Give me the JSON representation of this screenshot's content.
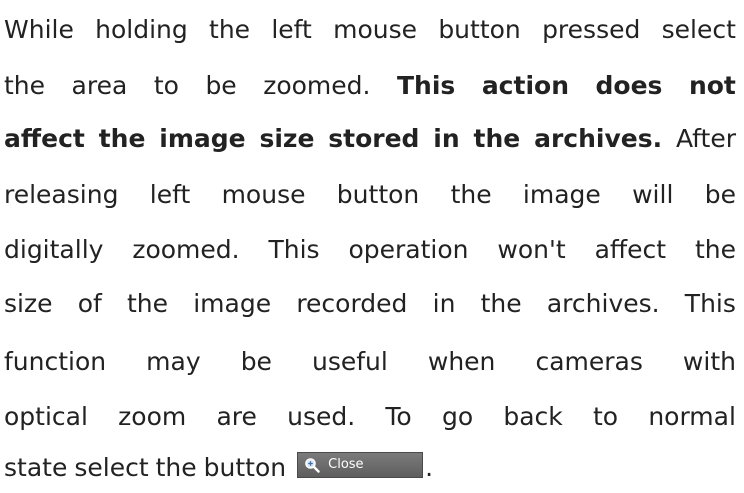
{
  "paragraph": {
    "lines": [
      [
        {
          "t": "While"
        },
        {
          "t": "holding"
        },
        {
          "t": "the"
        },
        {
          "t": "left"
        },
        {
          "t": "mouse"
        },
        {
          "t": "button"
        },
        {
          "t": "pressed"
        },
        {
          "t": "select"
        }
      ],
      [
        {
          "t": "the"
        },
        {
          "t": "area"
        },
        {
          "t": "to"
        },
        {
          "t": "be"
        },
        {
          "t": "zoomed."
        },
        {
          "t": "This",
          "b": true
        },
        {
          "t": "action",
          "b": true
        },
        {
          "t": "does",
          "b": true
        },
        {
          "t": "not",
          "b": true
        }
      ],
      [
        {
          "t": "affect",
          "b": true
        },
        {
          "t": "the",
          "b": true
        },
        {
          "t": "image",
          "b": true
        },
        {
          "t": "size",
          "b": true
        },
        {
          "t": "stored",
          "b": true
        },
        {
          "t": "in",
          "b": true
        },
        {
          "t": "the",
          "b": true
        },
        {
          "t": "archives.",
          "b": true
        },
        {
          "t": "After"
        }
      ],
      [
        {
          "t": "releasing"
        },
        {
          "t": "left"
        },
        {
          "t": "mouse"
        },
        {
          "t": "button"
        },
        {
          "t": "the"
        },
        {
          "t": "image"
        },
        {
          "t": "will"
        },
        {
          "t": "be"
        }
      ],
      [
        {
          "t": "digitally"
        },
        {
          "t": "zoomed."
        },
        {
          "t": "This"
        },
        {
          "t": "operation"
        },
        {
          "t": "won't"
        },
        {
          "t": "affect"
        },
        {
          "t": "the"
        }
      ],
      [
        {
          "t": "size"
        },
        {
          "t": "of"
        },
        {
          "t": "the"
        },
        {
          "t": "image"
        },
        {
          "t": "recorded"
        },
        {
          "t": "in"
        },
        {
          "t": "the"
        },
        {
          "t": "archives."
        },
        {
          "t": "This"
        }
      ],
      [
        {
          "t": "function"
        },
        {
          "t": "may"
        },
        {
          "t": "be"
        },
        {
          "t": "useful"
        },
        {
          "t": "when"
        },
        {
          "t": "cameras"
        },
        {
          "t": "with"
        }
      ],
      [
        {
          "t": "optical"
        },
        {
          "t": "zoom"
        },
        {
          "t": "are"
        },
        {
          "t": "used."
        },
        {
          "t": "To"
        },
        {
          "t": "go"
        },
        {
          "t": "back"
        },
        {
          "t": "to"
        },
        {
          "t": "normal"
        }
      ],
      [
        {
          "t": "state"
        },
        {
          "t": "select"
        },
        {
          "t": "the"
        },
        {
          "t": "button"
        }
      ]
    ],
    "trailing_period": "."
  },
  "close_button": {
    "label": "Close",
    "icon": "zoom-magnifier-icon"
  }
}
